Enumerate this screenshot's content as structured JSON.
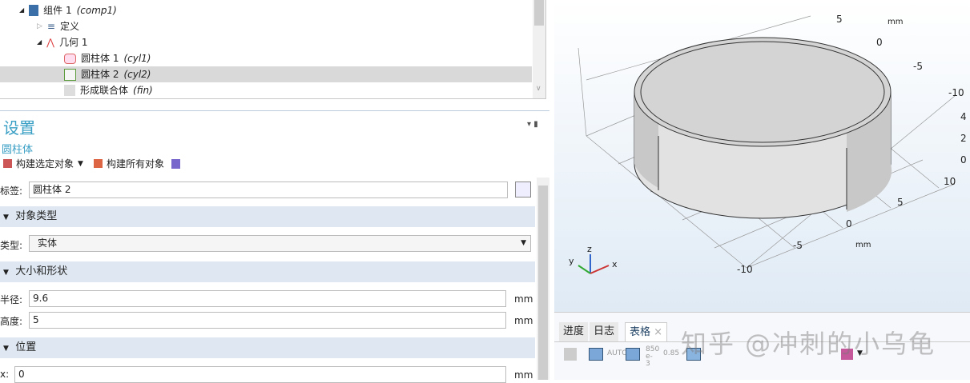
{
  "tree": {
    "items": [
      {
        "label": "组件 1",
        "tag": "(comp1)"
      },
      {
        "label": "定义",
        "tag": ""
      },
      {
        "label": "几何 1",
        "tag": ""
      },
      {
        "label": "圆柱体 1",
        "tag": "(cyl1)"
      },
      {
        "label": "圆柱体 2",
        "tag": "(cyl2)",
        "selected": true
      },
      {
        "label": "形成联合体",
        "tag": "(fin)"
      }
    ]
  },
  "settings": {
    "title": "设置",
    "subtitle": "圆柱体",
    "build_selected": "构建选定对象",
    "build_all": "构建所有对象",
    "label_label": "标签:",
    "label_value": "圆柱体 2",
    "sec_object_type": "对象类型",
    "type_label": "类型:",
    "type_value": "实体",
    "sec_size": "大小和形状",
    "radius_label": "半径:",
    "radius_value": "9.6",
    "radius_unit": "mm",
    "height_label": "高度:",
    "height_value": "5",
    "height_unit": "mm",
    "sec_position": "位置",
    "x_label": "x:",
    "x_value": "0",
    "x_unit": "mm"
  },
  "view": {
    "ticks_top": [
      "5",
      "mm",
      "0",
      "-5",
      "-10"
    ],
    "ticks_right": [
      "4",
      "2",
      "0"
    ],
    "ticks_bottom": [
      "10",
      "5",
      "0",
      "-5",
      "mm",
      "-10"
    ],
    "axes": [
      "z",
      "y",
      "x"
    ]
  },
  "bottom": {
    "tabs": [
      "进度",
      "日志",
      "表格"
    ],
    "toolbar": [
      "AUTO",
      "850 e-3",
      "0.85"
    ]
  },
  "watermark": "知乎 @冲刺的小乌龟"
}
